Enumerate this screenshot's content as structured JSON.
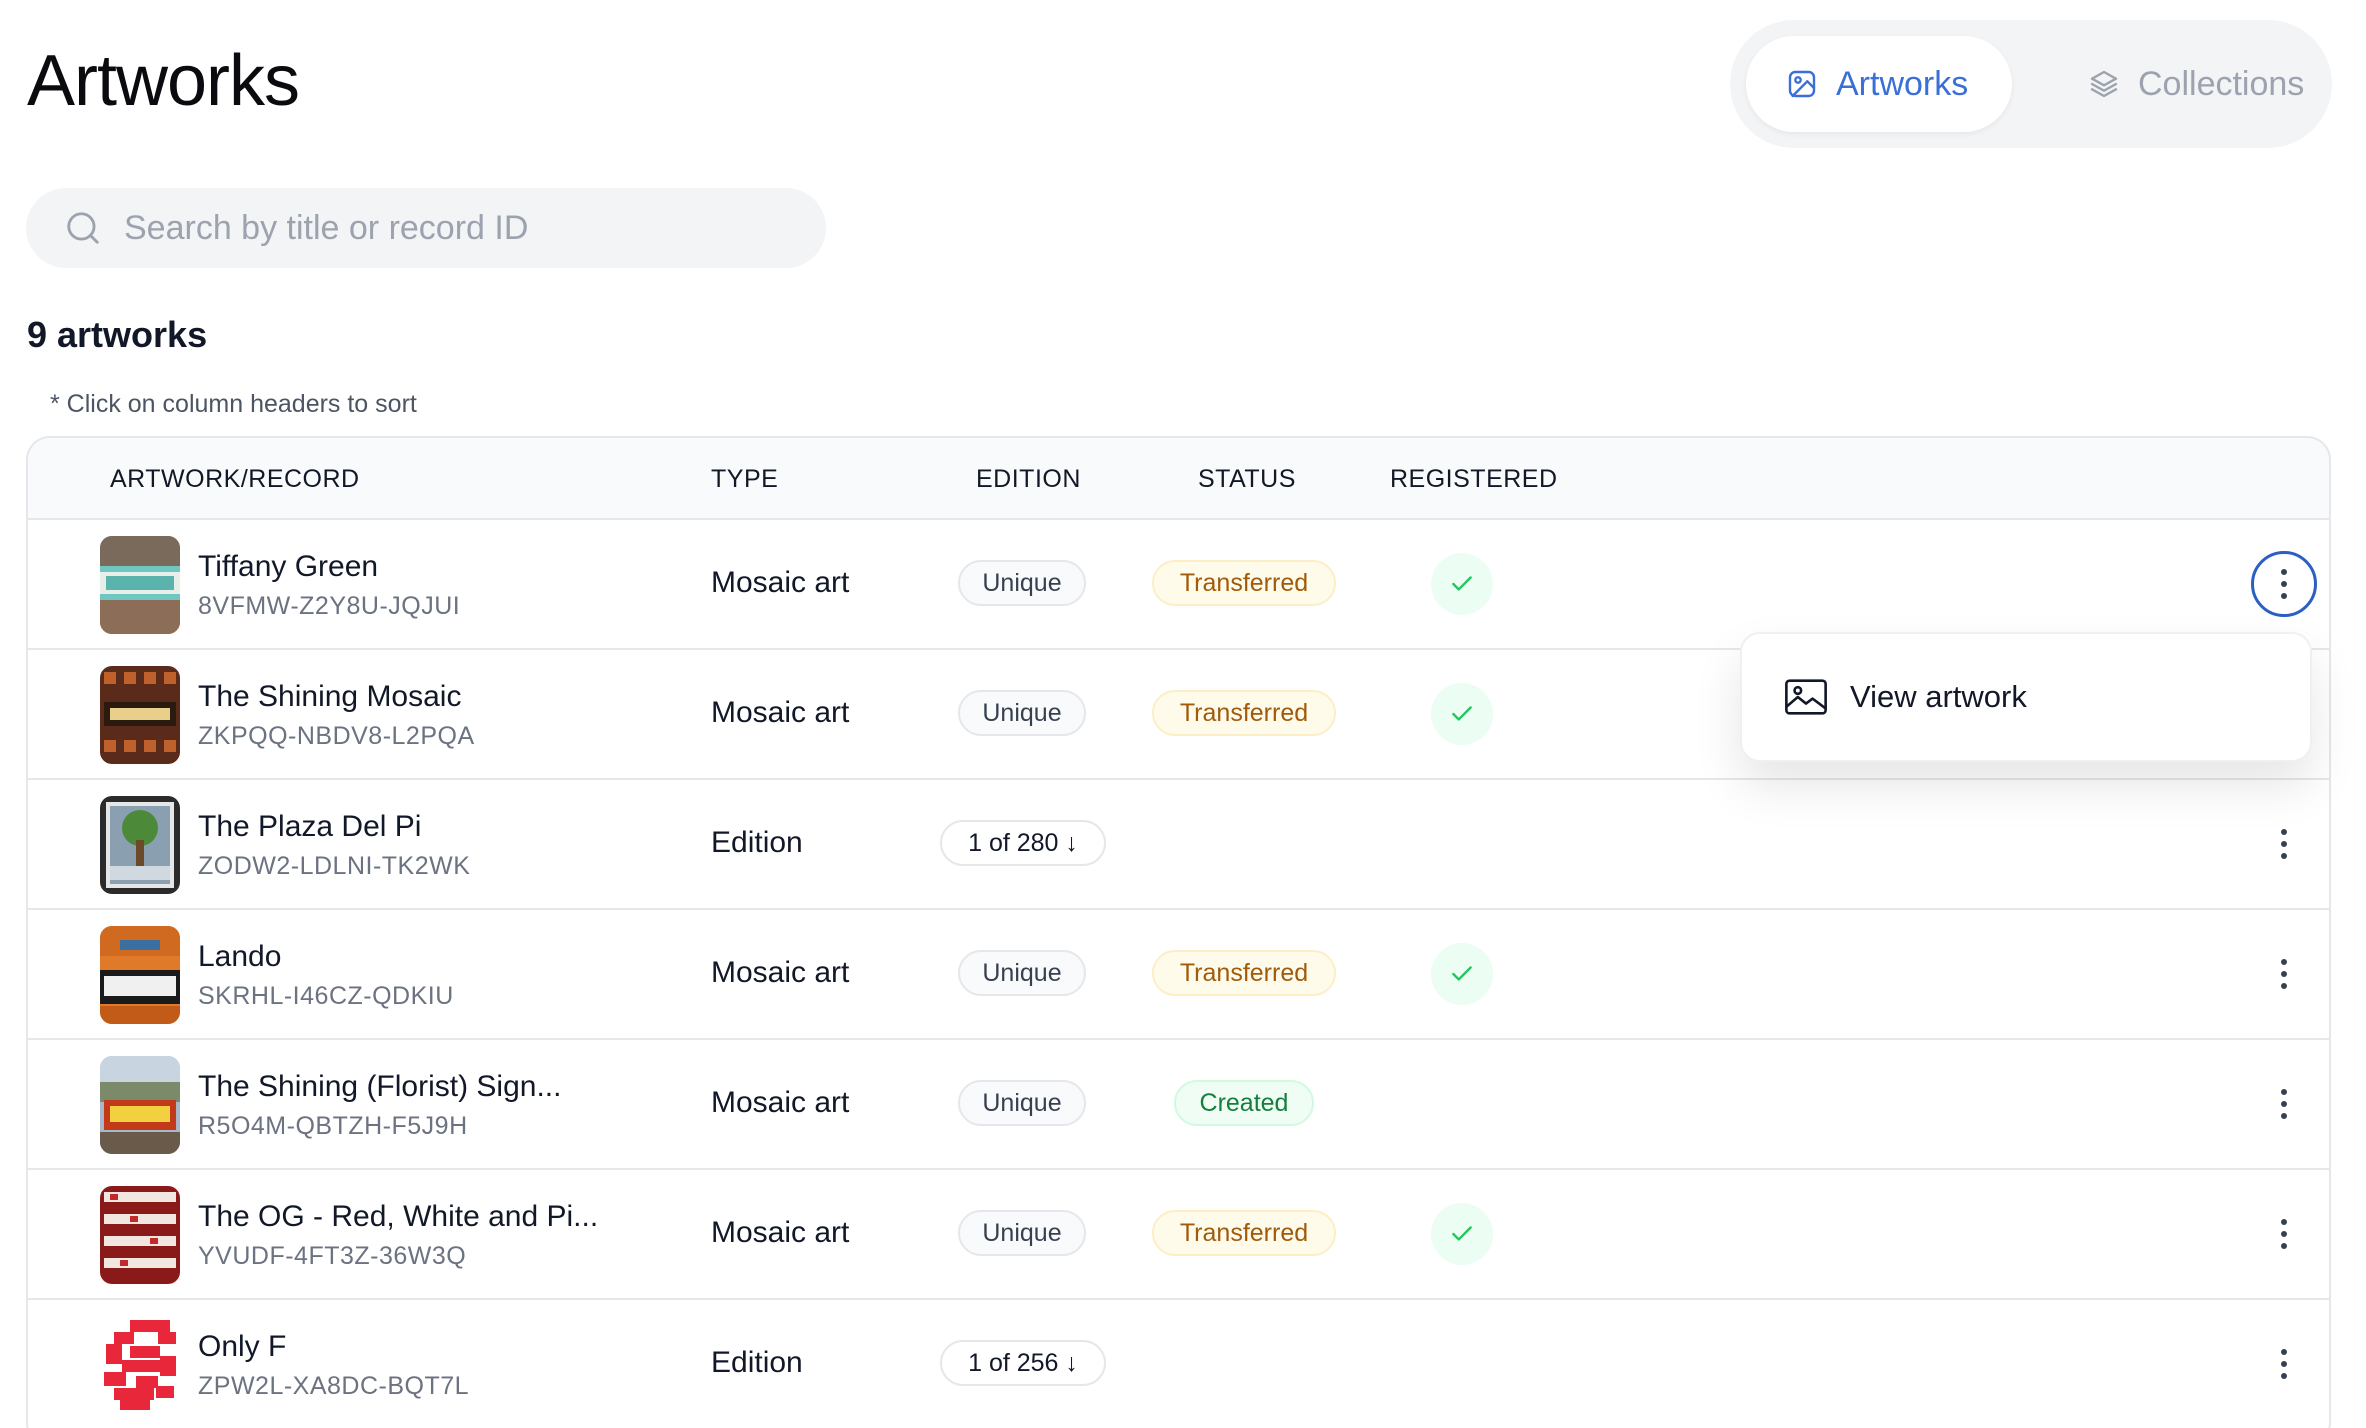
{
  "header": {
    "title": "Artworks"
  },
  "switcher": {
    "artworks_label": "Artworks",
    "collections_label": "Collections"
  },
  "search": {
    "placeholder": "Search by title or record ID",
    "value": ""
  },
  "summary": {
    "count_label": "9 artworks",
    "sort_hint": "* Click on column headers to sort"
  },
  "table": {
    "columns": [
      "ARTWORK/RECORD",
      "TYPE",
      "EDITION",
      "STATUS",
      "REGISTERED"
    ],
    "rows": [
      {
        "title": "Tiffany Green",
        "record_id": "8VFMW-Z2Y8U-JQJUI",
        "type": "Mosaic art",
        "edition": "Unique",
        "status": "Transferred",
        "registered": true
      },
      {
        "title": "The Shining Mosaic",
        "record_id": "ZKPQQ-NBDV8-L2PQA",
        "type": "Mosaic art",
        "edition": "Unique",
        "status": "Transferred",
        "registered": true
      },
      {
        "title": "The Plaza Del Pi",
        "record_id": "ZODW2-LDLNI-TK2WK",
        "type": "Edition",
        "edition": "1 of 280 ↓",
        "status": "",
        "registered": false
      },
      {
        "title": "Lando",
        "record_id": "SKRHL-I46CZ-QDKIU",
        "type": "Mosaic art",
        "edition": "Unique",
        "status": "Transferred",
        "registered": true
      },
      {
        "title": "The Shining (Florist) Sign...",
        "record_id": "R5O4M-QBTZH-F5J9H",
        "type": "Mosaic art",
        "edition": "Unique",
        "status": "Created",
        "registered": false
      },
      {
        "title": "The OG - Red, White and Pi...",
        "record_id": "YVUDF-4FT3Z-36W3Q",
        "type": "Mosaic art",
        "edition": "Unique",
        "status": "Transferred",
        "registered": true
      },
      {
        "title": "Only F",
        "record_id": "ZPW2L-XA8DC-BQT7L",
        "type": "Edition",
        "edition": "1 of 256 ↓",
        "status": "",
        "registered": false
      }
    ]
  },
  "context_menu": {
    "view_artwork_label": "View artwork"
  },
  "colors": {
    "accent": "#3b6fd8",
    "transferred": "#a05a0a",
    "created": "#15803d",
    "check": "#22c55e"
  }
}
